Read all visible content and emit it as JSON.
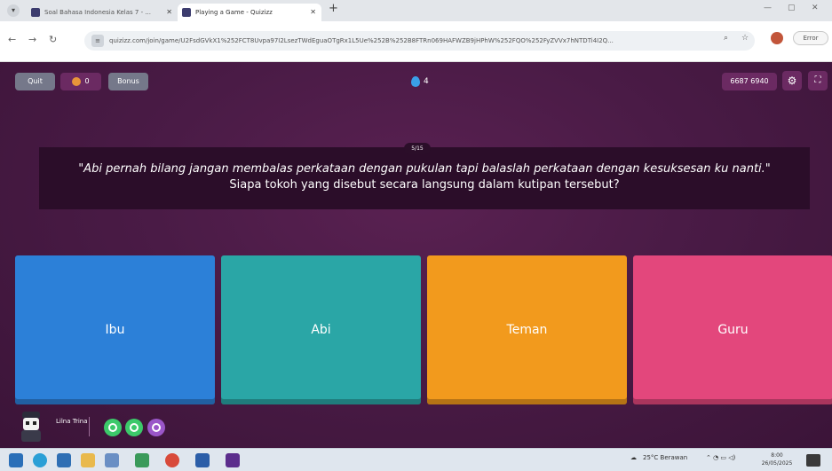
{
  "browser": {
    "tabs": [
      {
        "title": "Soal Bahasa Indonesia Kelas 7 - ...",
        "active": false
      },
      {
        "title": "Playing a Game - Quizizz",
        "active": true
      }
    ],
    "new_tab_icon": "plus-icon",
    "url": "quizizz.com/join/game/U2FsdGVkX1%252FCT8Uvpa97I2LsezTWdEguaOTgRx1L5Ue%252B%252B8FTRn069HAFWZB9jHPhW%252FQO%252FyZVVx7hNTDTi4I2Q...",
    "error_button": "Error"
  },
  "game": {
    "quit_label": "Quit",
    "coins": "0",
    "bonus_label": "Bonus",
    "streak": "4",
    "score": "6687 6940",
    "question_counter": "5/15",
    "question_quote": "\"Abi pernah bilang jangan membalas perkataan dengan pukulan tapi balaslah perkataan dengan kesuksesan ku nanti.\"",
    "question_text": "Siapa tokoh yang disebut secara langsung dalam kutipan tersebut?",
    "answers": [
      {
        "label": "Ibu",
        "color": "#2c80d8"
      },
      {
        "label": "Abi",
        "color": "#2aa6a6"
      },
      {
        "label": "Teman",
        "color": "#f29a1d"
      },
      {
        "label": "Guru",
        "color": "#e3477c"
      }
    ],
    "player_name": "Lilna Trina"
  },
  "taskbar": {
    "weather": "25°C Berawan",
    "time": "8:00",
    "date": "26/05/2025"
  }
}
